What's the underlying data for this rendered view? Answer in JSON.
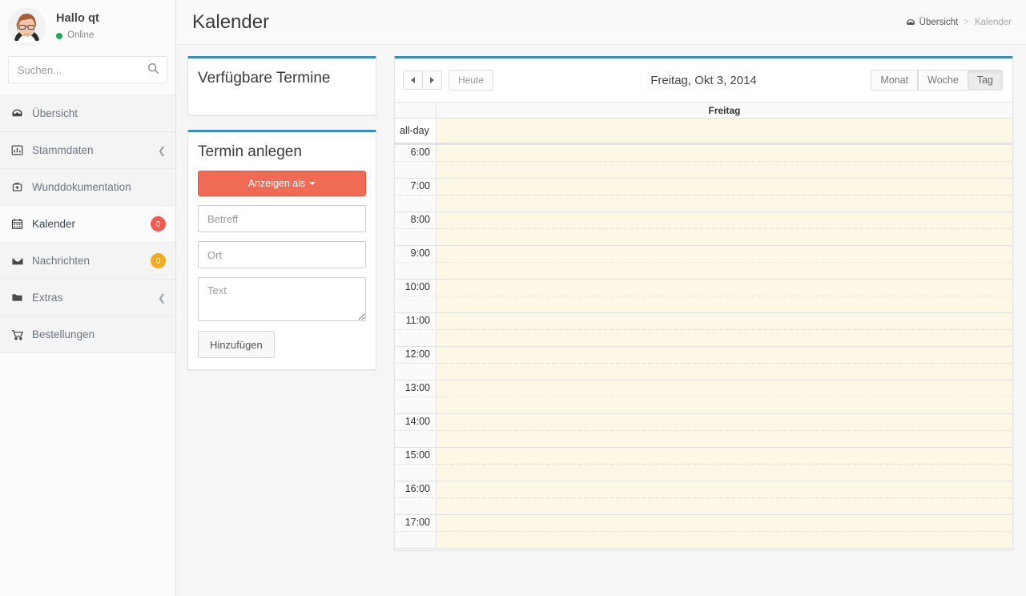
{
  "sidebar": {
    "user": {
      "name": "Hallo qt",
      "status": "Online"
    },
    "search": {
      "value": "",
      "placeholder": "Suchen..."
    },
    "items": [
      {
        "label": "Übersicht",
        "icon": "dashboard-icon",
        "badge": null,
        "chevron": false,
        "active": false
      },
      {
        "label": "Stammdaten",
        "icon": "chart-bar-icon",
        "badge": null,
        "chevron": true,
        "active": false
      },
      {
        "label": "Wunddokumentation",
        "icon": "medical-kit-icon",
        "badge": null,
        "chevron": false,
        "active": false
      },
      {
        "label": "Kalender",
        "icon": "calendar-icon",
        "badge": "0",
        "badge_color": "#f05b4f",
        "chevron": false,
        "active": true
      },
      {
        "label": "Nachrichten",
        "icon": "envelope-icon",
        "badge": "0",
        "badge_color": "#f0ad20",
        "chevron": false,
        "active": false
      },
      {
        "label": "Extras",
        "icon": "folder-icon",
        "badge": null,
        "chevron": true,
        "active": false
      },
      {
        "label": "Bestellungen",
        "icon": "shopping-cart-icon",
        "badge": null,
        "chevron": false,
        "active": false
      }
    ]
  },
  "header": {
    "title": "Kalender",
    "breadcrumb": {
      "home": "Übersicht",
      "separator": ">",
      "current": "Kalender"
    }
  },
  "left_panels": {
    "available": {
      "title": "Verfügbare Termine"
    },
    "create": {
      "title": "Termin anlegen",
      "display_as_button": "Anzeigen als",
      "subject": {
        "value": "",
        "placeholder": "Betreff"
      },
      "location": {
        "value": "",
        "placeholder": "Ort"
      },
      "text": {
        "value": "",
        "placeholder": "Text"
      },
      "add_button": "Hinzufügen"
    }
  },
  "calendar": {
    "prev_label": "prev",
    "next_label": "next",
    "today_label": "Heute",
    "title": "Freitag, Okt 3, 2014",
    "views": [
      {
        "label": "Monat",
        "active": false
      },
      {
        "label": "Woche",
        "active": false
      },
      {
        "label": "Tag",
        "active": true
      }
    ],
    "day_header": "Freitag",
    "allday_label": "all-day",
    "hours": [
      "6:00",
      "7:00",
      "8:00",
      "9:00",
      "10:00",
      "11:00",
      "12:00",
      "13:00",
      "14:00",
      "15:00",
      "16:00",
      "17:00"
    ],
    "events": [],
    "colors": {
      "panel_top": "#3c8dbc",
      "slot_bg": "#fdf8e6",
      "accent_orange": "#ef6b55"
    }
  }
}
